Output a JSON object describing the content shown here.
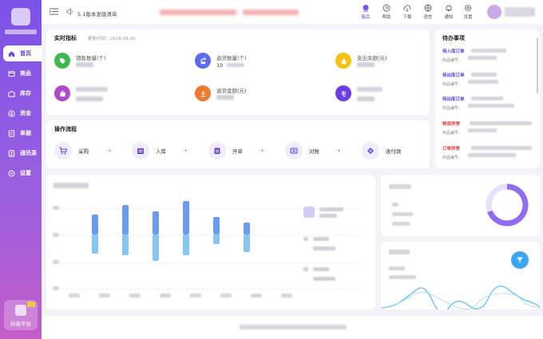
{
  "sidebar": {
    "items": [
      {
        "label": "首页",
        "icon": "home-icon"
      },
      {
        "label": "商品",
        "icon": "goods-icon"
      },
      {
        "label": "库存",
        "icon": "inventory-icon"
      },
      {
        "label": "资金",
        "icon": "funds-icon"
      },
      {
        "label": "单据",
        "icon": "documents-icon"
      },
      {
        "label": "通讯录",
        "icon": "contacts-icon"
      },
      {
        "label": "设置",
        "icon": "settings-icon"
      }
    ],
    "promo_label": "抖音平台"
  },
  "header": {
    "notice": "5.1版本发版清单",
    "icons": [
      {
        "label": "售后",
        "icon": "after-sales-icon"
      },
      {
        "label": "帮助",
        "icon": "help-icon"
      },
      {
        "label": "下载",
        "icon": "download-icon"
      },
      {
        "label": "语言",
        "icon": "language-icon"
      },
      {
        "label": "通知",
        "icon": "bell-icon"
      },
      {
        "label": "设置",
        "icon": "gear-icon"
      }
    ]
  },
  "realtime": {
    "title": "实时指标",
    "update_time": "更新时间：2024-09-20",
    "metrics": [
      {
        "label": "销售数量(个)",
        "value": "",
        "color": "#3fb950"
      },
      {
        "label": "退货数量(个)",
        "value": "10",
        "color": "#5b6cf0"
      },
      {
        "label": "支出余额(元)",
        "value": "",
        "color": "#f4c20d"
      },
      {
        "label": "",
        "value": "",
        "color": "#b04ac9"
      },
      {
        "label": "退货金额(元)",
        "value": "",
        "color": "#f07b2c"
      },
      {
        "label": "",
        "value": "",
        "color": "#6b3ee8"
      }
    ]
  },
  "flow": {
    "title": "操作流程",
    "steps": [
      {
        "label": "采购",
        "icon": "cart-icon"
      },
      {
        "label": "入库",
        "icon": "warehouse-in-icon"
      },
      {
        "label": "开单",
        "icon": "bill-icon"
      },
      {
        "label": "对账",
        "icon": "reconcile-icon"
      },
      {
        "label": "收付款",
        "icon": "payment-icon"
      }
    ]
  },
  "todo": {
    "title": "待办事项",
    "items": [
      {
        "tag": "待入库订单",
        "color": "#5b3ee8",
        "sub": "商品编号："
      },
      {
        "tag": "待出库订单",
        "color": "#5b3ee8",
        "sub": "商品编号："
      },
      {
        "tag": "待出库订单",
        "color": "#5b3ee8",
        "sub": "商品编号："
      },
      {
        "tag": "物流异常",
        "color": "#e23b3b",
        "sub": "商品编号："
      },
      {
        "tag": "订单异常",
        "color": "#e23b3b",
        "sub": "商品编号："
      }
    ]
  },
  "colors": {
    "accent": "#6b3ee8",
    "bar_top": "#6b9cf2",
    "bar_bottom": "#86c6f4"
  }
}
